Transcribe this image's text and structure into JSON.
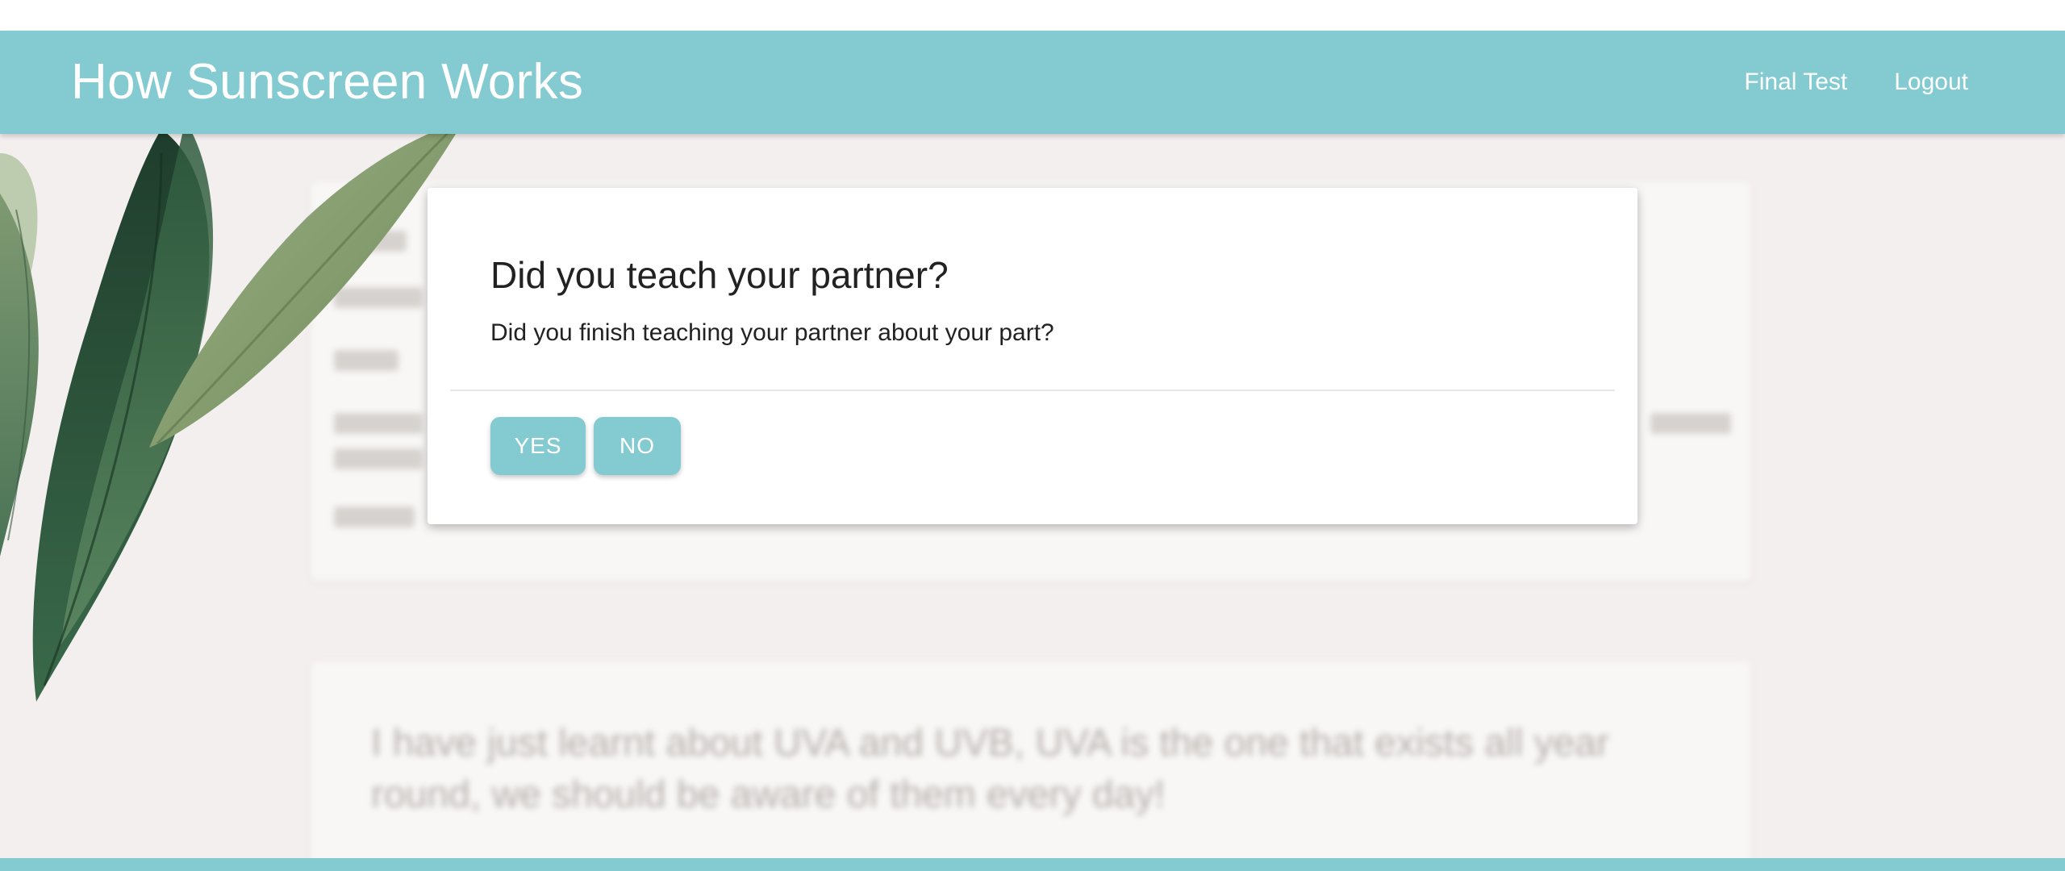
{
  "header": {
    "title": "How Sunscreen Works",
    "nav": [
      {
        "label": "Final Test"
      },
      {
        "label": "Logout"
      }
    ]
  },
  "background": {
    "card_b_text": "I have just learnt about UVA and UVB, UVA is the one that exists all year round, we should be aware of them every day!"
  },
  "modal": {
    "title": "Did you teach your partner?",
    "body": "Did you finish teaching your partner about your part?",
    "yes_label": "YES",
    "no_label": "NO"
  },
  "colors": {
    "accent": "#83cad1",
    "page_background": "#f4efef",
    "modal_background": "#ffffff",
    "text": "#222222"
  }
}
